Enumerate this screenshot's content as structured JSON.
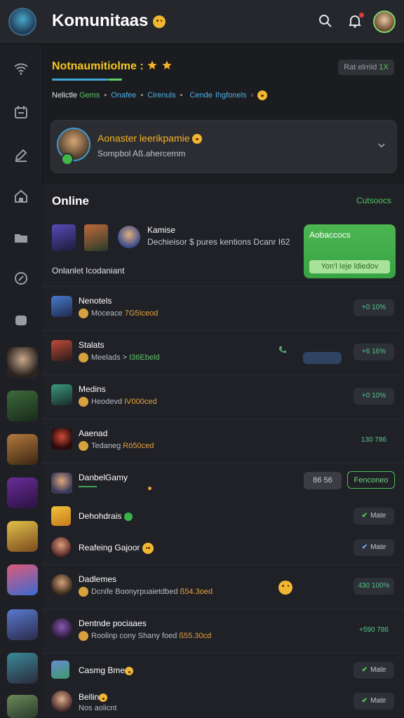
{
  "app": {
    "title": "Komunitaas"
  },
  "section": {
    "title": "Notnaumitiolme :",
    "pill_prefix": "Rat elrriid",
    "pill_value": "1X",
    "breadcrumb": [
      "Nelictle",
      "Gems",
      "Onafee",
      "Cirenuls",
      "Cende",
      "Ihgfonels"
    ]
  },
  "card": {
    "title": "Aonaster leerikpamie",
    "subtitle": "Sompbol Aß.ahercemm"
  },
  "online": {
    "title": "Online",
    "link": "Cutsoocs",
    "stat_title": "Kamise",
    "stat_sub": "Dechieisor $ pures kentions Dcanr I62",
    "promo_title": "Aobaccocs",
    "promo_button": "Yon'l Ieje ldiedov",
    "subtitle": "Onlanlet Icodaniant"
  },
  "rows": [
    {
      "name": "Nenotels",
      "sub": "Moceace",
      "highlight": "7G5Iceod",
      "hcolor": "orange",
      "badge": "+0 10%",
      "btype": "teal"
    },
    {
      "name": "Stalats",
      "sub": "Meelads >",
      "highlight": "I36Ebeld",
      "hcolor": "green",
      "badge": "+6 16%",
      "btype": "teal"
    },
    {
      "name": "Medins",
      "sub": "Heodevd",
      "highlight": "IV000ced",
      "hcolor": "orange",
      "badge": "+0 10%",
      "btype": "teal"
    },
    {
      "name": "Aaenad",
      "sub": "Tedaneg",
      "highlight": "Rö50ced",
      "hcolor": "orange",
      "badge": "130 786",
      "btype": "plain"
    },
    {
      "name": "DanbelGamy",
      "sub": "",
      "highlight": "",
      "hcolor": "green",
      "badge": "",
      "btype": "none"
    },
    {
      "name": "Dehohdrais",
      "sub": "",
      "highlight": "",
      "hcolor": "green",
      "badge": "Mate",
      "btype": "check"
    },
    {
      "name": "Reafeing Gajoor",
      "sub": "",
      "highlight": "",
      "hcolor": "green",
      "badge": "Mate",
      "btype": "checkb"
    },
    {
      "name": "Dadlemes",
      "sub": "Dcnife Boonyrpuaietdbed",
      "highlight": "ß54.3oed",
      "hcolor": "orange",
      "badge": "430 100%",
      "btype": "teal"
    },
    {
      "name": "Dentnde pociaaes",
      "sub": "Roolinp cony Shany foed",
      "highlight": "ß55.30cd",
      "hcolor": "orange",
      "badge": "+590 786",
      "btype": "plain"
    },
    {
      "name": "Casmg Bme",
      "sub": "",
      "highlight": "",
      "hcolor": "green",
      "badge": "Mate",
      "btype": "check"
    },
    {
      "name": "Bellin",
      "sub": "Nos aolicnt",
      "highlight": "",
      "hcolor": "green",
      "badge": "Mate",
      "btype": "check"
    }
  ],
  "row5": {
    "chip": "86 56",
    "button": "Fenconeo"
  },
  "colors": {
    "accent": "#f5c623",
    "green": "#4cb651",
    "bg": "#1b1c20"
  },
  "icons": [
    "wifi-icon",
    "calendar-icon",
    "edit-icon",
    "home-icon",
    "folder-icon",
    "link-icon",
    "chat-icon",
    "search-icon",
    "bell-icon",
    "chevron-down-icon",
    "phone-icon",
    "check-icon"
  ]
}
